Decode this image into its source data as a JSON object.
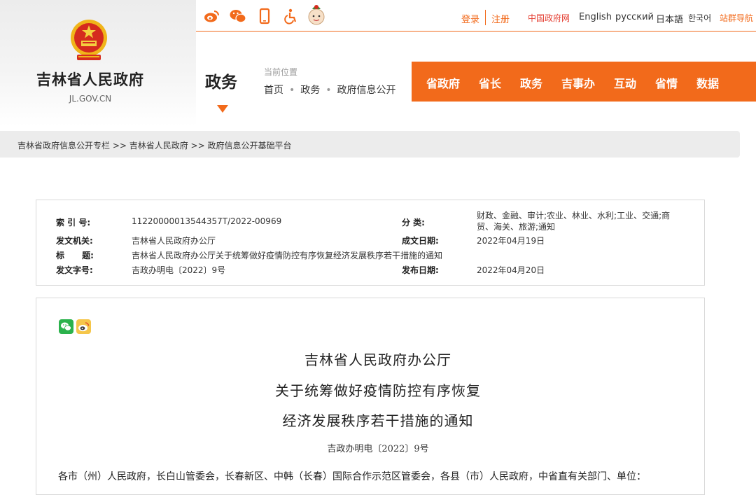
{
  "site": {
    "title": "吉林省人民政府",
    "domain": "JL.GOV.CN",
    "emblem_icon": "national-emblem-icon"
  },
  "section": {
    "title": "政务",
    "location_label": "当前位置",
    "location_path": [
      "首页",
      "政务",
      "政府信息公开"
    ]
  },
  "top_icons": [
    "weibo-icon",
    "wechat-icon",
    "mobile-icon",
    "accessibility-icon",
    "mascot-icon"
  ],
  "top_links": {
    "login": "登录",
    "register": "注册",
    "cn_gov": "中国政府网",
    "english": "English",
    "russian": "русский",
    "japanese": "日本語",
    "korean": "한국어",
    "site_nav": "站群导航"
  },
  "nav": [
    "省政府",
    "省长",
    "政务",
    "吉事办",
    "互动",
    "省情",
    "数据"
  ],
  "breadcrumb": "吉林省政府信息公开专栏 >> 吉林省人民政府 >> 政府信息公开基础平台",
  "meta": {
    "index_label": "索 引 号:",
    "index_value": "11220000013544357T/2022-00969",
    "category_label": "分 类:",
    "category_value": "财政、金融、审计;农业、林业、水利;工业、交通;商贸、海关、旅游;通知",
    "issuer_label": "发文机关:",
    "issuer_value": "吉林省人民政府办公厅",
    "created_label": "成文日期:",
    "created_value": "2022年04月19日",
    "title_label": "标      题:",
    "title_value": "吉林省人民政府办公厅关于统筹做好疫情防控有序恢复经济发展秩序若干措施的通知",
    "docno_label": "发文字号:",
    "docno_value": "吉政办明电〔2022〕9号",
    "published_label": "发布日期:",
    "published_value": "2022年04月20日"
  },
  "share_icons": [
    "wechat-share-icon",
    "weibo-share-icon"
  ],
  "document": {
    "title_lines": [
      "吉林省人民政府办公厅",
      "关于统筹做好疫情防控有序恢复",
      "经济发展秩序若干措施的通知"
    ],
    "doc_number": "吉政办明电〔2022〕9号",
    "first_line": "各市（州）人民政府，长白山管委会，长春新区、中韩（长春）国际合作示范区管委会，各县（市）人民政府，中省直有关部门、单位："
  },
  "colors": {
    "accent": "#f26a1b",
    "nav_text": "#ffffff",
    "cn_gov_link": "#e43c2f"
  }
}
